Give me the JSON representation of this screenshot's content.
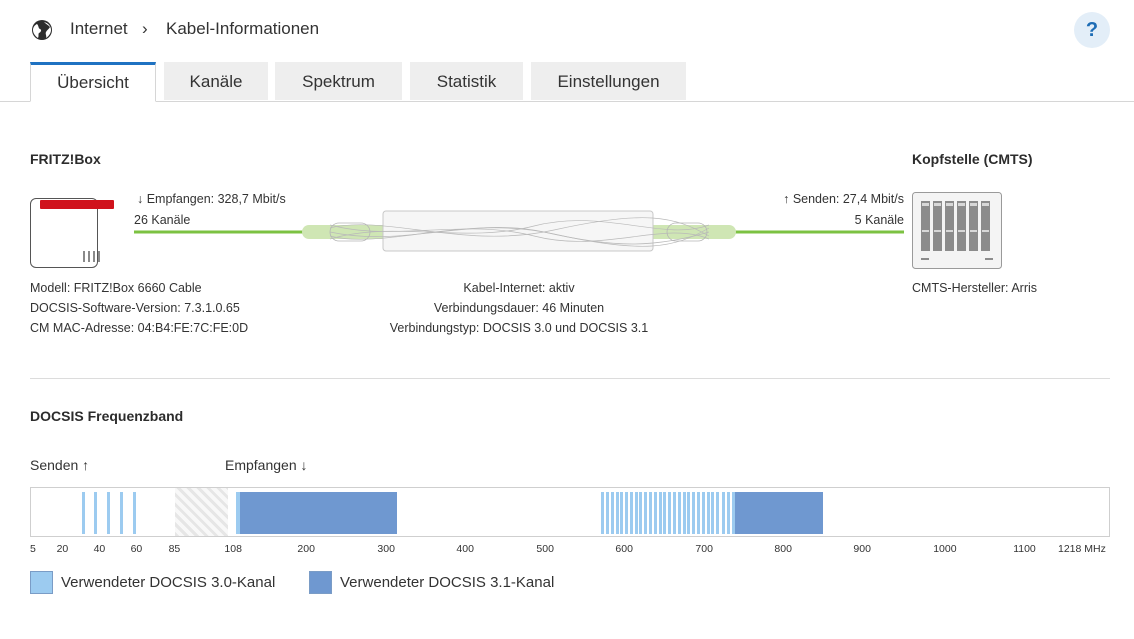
{
  "header": {
    "breadcrumb_root": "Internet",
    "breadcrumb_sep": "›",
    "breadcrumb_current": "Kabel-Informationen",
    "help_label": "?"
  },
  "tabs": [
    {
      "label": "Übersicht",
      "active": true
    },
    {
      "label": "Kanäle",
      "active": false
    },
    {
      "label": "Spektrum",
      "active": false
    },
    {
      "label": "Statistik",
      "active": false
    },
    {
      "label": "Einstellungen",
      "active": false
    }
  ],
  "overview": {
    "fritzbox_title": "FRITZ!Box",
    "cmts_title": "Kopfstelle (CMTS)",
    "receive_label": "↓ Empfangen: 328,7 Mbit/s",
    "receive_channels": "26 Kanäle",
    "send_label": "↑ Senden: 27,4 Mbit/s",
    "send_channels": "5 Kanäle",
    "model": "Modell: FRITZ!Box 6660 Cable",
    "docsis_sw": "DOCSIS-Software-Version: 7.3.1.0.65",
    "cm_mac": "CM MAC-Adresse: 04:B4:FE:7C:FE:0D",
    "cable_internet": "Kabel-Internet: aktiv",
    "duration": "Verbindungsdauer: 46 Minuten",
    "conn_type": "Verbindungstyp: DOCSIS 3.0 und DOCSIS 3.1",
    "cmts_vendor": "CMTS-Hersteller: Arris"
  },
  "band": {
    "title": "DOCSIS Frequenzband",
    "send_label": "Senden",
    "send_arrow": "↑",
    "receive_label": "Empfangen",
    "receive_arrow": "↓",
    "unit": "MHz",
    "ticks": [
      {
        "mhz": 5,
        "label": "5"
      },
      {
        "mhz": 20,
        "label": "20"
      },
      {
        "mhz": 40,
        "label": "40"
      },
      {
        "mhz": 60,
        "label": "60"
      },
      {
        "mhz": 85,
        "label": "85"
      },
      {
        "mhz": 108,
        "label": "108"
      },
      {
        "mhz": 200,
        "label": "200"
      },
      {
        "mhz": 300,
        "label": "300"
      },
      {
        "mhz": 400,
        "label": "400"
      },
      {
        "mhz": 500,
        "label": "500"
      },
      {
        "mhz": 600,
        "label": "600"
      },
      {
        "mhz": 700,
        "label": "700"
      },
      {
        "mhz": 800,
        "label": "800"
      },
      {
        "mhz": 900,
        "label": "900"
      },
      {
        "mhz": 1000,
        "label": "1000"
      },
      {
        "mhz": 1100,
        "label": "1100"
      },
      {
        "mhz": 1218,
        "label": "1218 MHz"
      }
    ],
    "upstream_channels_mhz": [
      30,
      37,
      44,
      51,
      58
    ],
    "guard_band_mhz": [
      85,
      108
    ],
    "downstream_30_channels_mhz": [
      111,
      114,
      570,
      576,
      582,
      588,
      594,
      600,
      606,
      612,
      618,
      624,
      630,
      636,
      642,
      648,
      654,
      660,
      666,
      672,
      678,
      684,
      690,
      696,
      702,
      708,
      714,
      722,
      728,
      734
    ],
    "downstream_31_blocks_mhz": [
      [
        115,
        313
      ],
      [
        738,
        850
      ]
    ],
    "colors": {
      "docsis30": "#9ccbf0",
      "docsis31": "#6f98d0",
      "line_green": "#7cc242",
      "router_red": "#d0121c"
    },
    "legend_30": "Verwendeter DOCSIS 3.0-Kanal",
    "legend_31": "Verwendeter DOCSIS 3.1-Kanal"
  }
}
